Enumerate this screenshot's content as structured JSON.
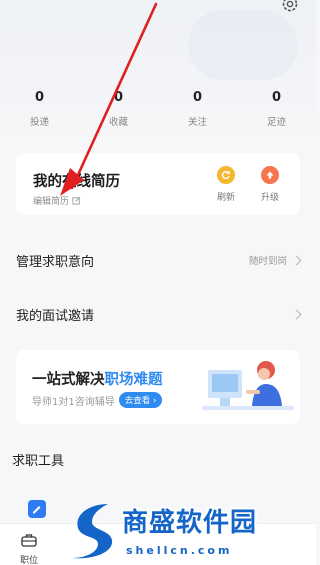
{
  "stats": [
    {
      "value": "0",
      "label": "投递"
    },
    {
      "value": "0",
      "label": "收藏"
    },
    {
      "value": "0",
      "label": "关注"
    },
    {
      "value": "0",
      "label": "足迹"
    }
  ],
  "resume": {
    "title": "我的在线简历",
    "edit_label": "编辑简历",
    "refresh_label": "刷新",
    "upgrade_label": "升级"
  },
  "rows": {
    "job_intent_title": "管理求职意向",
    "job_intent_status": "随时到岗",
    "interview_title": "我的面试邀请"
  },
  "banner": {
    "headline_prefix": "一站式解决",
    "headline_highlight": "职场难题",
    "subtitle": "导师1对1咨询辅导",
    "button_label": "去查看"
  },
  "tools": {
    "title": "求职工具"
  },
  "bottom_nav": {
    "jobs_label": "职位"
  },
  "watermark": {
    "name": "商盛软件园",
    "url": "shellcn.com"
  },
  "colors": {
    "accent": "#2f8bf0",
    "refresh": "#f5b72d",
    "upgrade": "#f5764d",
    "annotation_arrow": "#e02020"
  }
}
